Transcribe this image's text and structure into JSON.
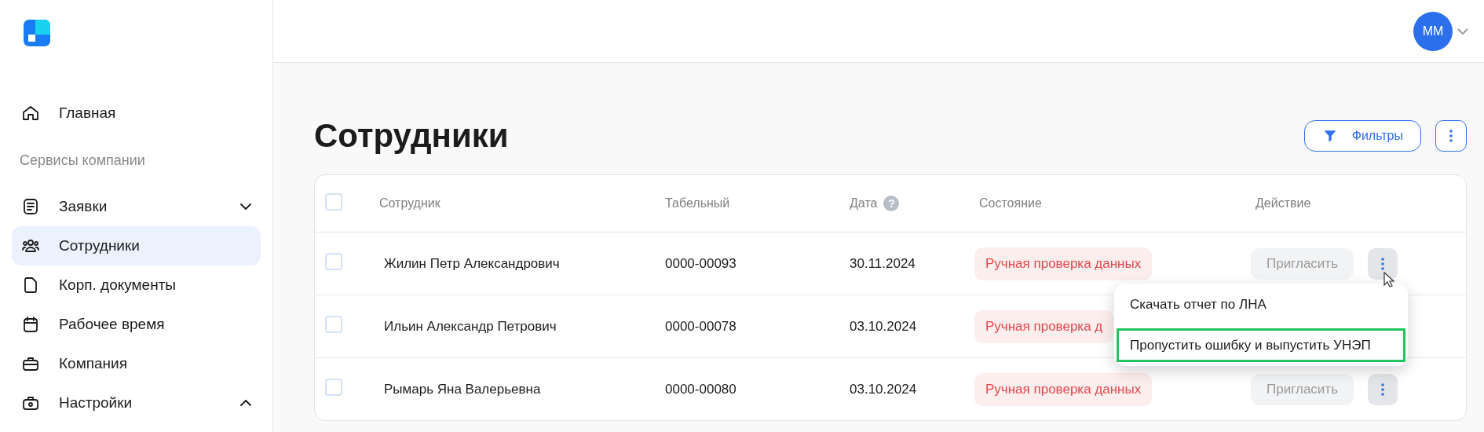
{
  "sidebar": {
    "top_items": [
      {
        "label": "Главная",
        "selected": false
      }
    ],
    "section_label": "Сервисы компании",
    "items": [
      {
        "label": "Заявки",
        "selected": false,
        "expanded": false
      },
      {
        "label": "Сотрудники",
        "selected": true
      },
      {
        "label": "Корп. документы",
        "selected": false
      },
      {
        "label": "Рабочее время",
        "selected": false
      },
      {
        "label": "Компания",
        "selected": false
      },
      {
        "label": "Настройки",
        "selected": false,
        "expanded": true
      }
    ]
  },
  "header": {
    "avatar": "ММ"
  },
  "page": {
    "title": "Сотрудники",
    "filters_button": "Фильтры"
  },
  "table": {
    "select_all_checked": false,
    "date_hint": "?",
    "columns": [
      "Сотрудник",
      "Табельный",
      "Дата",
      "Состояние",
      "Действие"
    ],
    "rows": [
      {
        "checked": false,
        "name": "Жилин Петр Александрович",
        "number": "0000-00093",
        "date": "30.11.2024",
        "status": "Ручная проверка данных",
        "invite": "Пригласить",
        "menu_button": true
      },
      {
        "checked": false,
        "name": "Ильин Александр Петрович",
        "number": "0000-00078",
        "date": "03.10.2024",
        "status": "Ручная проверка д"
      },
      {
        "checked": false,
        "name": "Рымарь Яна Валерьевна",
        "number": "0000-00080",
        "date": "03.10.2024",
        "status": "Ручная проверка данных",
        "invite": "Пригласить",
        "menu_button": true
      }
    ],
    "menu": {
      "items": [
        {
          "label": "Скачать отчет по ЛНА",
          "highlighted": false
        },
        {
          "label": "Пропустить ошибку и выпустить УНЭП",
          "highlighted": true
        }
      ]
    }
  }
}
